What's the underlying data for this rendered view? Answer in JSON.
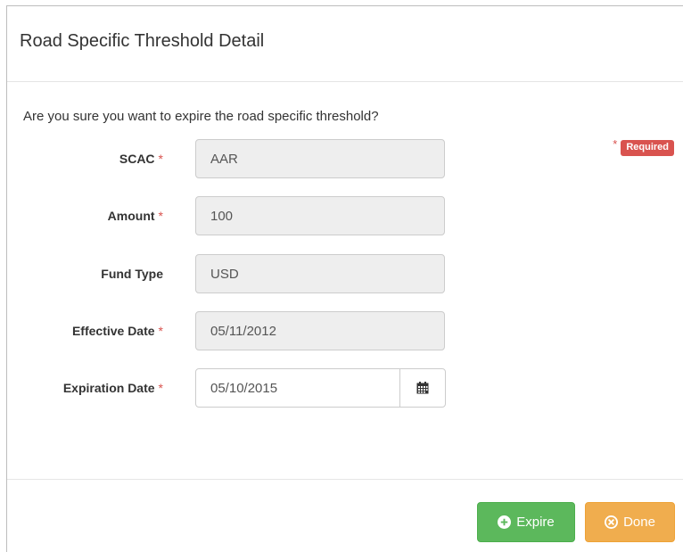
{
  "modal": {
    "title": "Road Specific Threshold Detail",
    "question": "Are you sure you want to expire the road specific threshold?",
    "required_star": "*",
    "required_badge": "Required"
  },
  "form": {
    "required_marker": "*",
    "fields": [
      {
        "label": "SCAC",
        "value": "AAR",
        "required": true
      },
      {
        "label": "Amount",
        "value": "100",
        "required": true
      },
      {
        "label": "Fund Type",
        "value": "USD",
        "required": false
      },
      {
        "label": "Effective Date",
        "value": "05/11/2012",
        "required": true
      },
      {
        "label": "Expiration Date",
        "value": "05/10/2015",
        "required": true
      }
    ],
    "calendar_icon": "calendar-icon"
  },
  "footer": {
    "expire_label": "Expire",
    "expire_icon": "plus-circle-icon",
    "done_label": "Done",
    "done_icon": "times-circle-icon"
  },
  "colors": {
    "required": "#d9534f",
    "success": "#5cb85c",
    "warning": "#f0ad4e",
    "readonly_bg": "#eeeeee"
  }
}
